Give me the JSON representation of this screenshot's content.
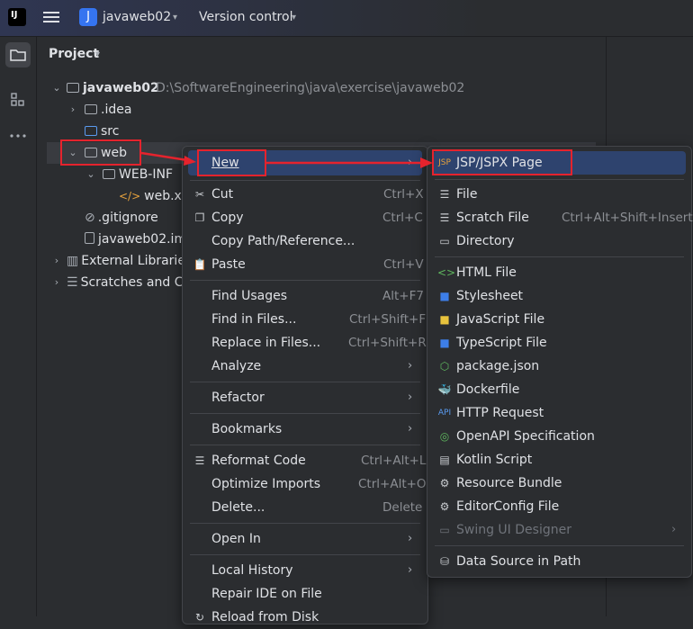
{
  "titlebar": {
    "logo": "IJ",
    "project_badge": "J",
    "project_name": "javaweb02",
    "vcs": "Version control"
  },
  "project_panel": {
    "title": "Project",
    "tree": {
      "root_name": "javaweb02",
      "root_path": "D:\\SoftwareEngineering\\java\\exercise\\javaweb02",
      "idea": ".idea",
      "src": "src",
      "web": "web",
      "webinf": "WEB-INF",
      "webxml": "web.xml",
      "gitignore": ".gitignore",
      "iml": "javaweb02.iml",
      "ext_libs": "External Libraries",
      "scratches": "Scratches and Consoles"
    }
  },
  "context_menu": {
    "new": "New",
    "cut": "Cut",
    "cut_sc": "Ctrl+X",
    "copy": "Copy",
    "copy_sc": "Ctrl+C",
    "copy_path": "Copy Path/Reference...",
    "paste": "Paste",
    "paste_sc": "Ctrl+V",
    "find_usages": "Find Usages",
    "find_usages_sc": "Alt+F7",
    "find_files": "Find in Files...",
    "find_files_sc": "Ctrl+Shift+F",
    "replace_files": "Replace in Files...",
    "replace_files_sc": "Ctrl+Shift+R",
    "analyze": "Analyze",
    "refactor": "Refactor",
    "bookmarks": "Bookmarks",
    "reformat": "Reformat Code",
    "reformat_sc": "Ctrl+Alt+L",
    "optimize": "Optimize Imports",
    "optimize_sc": "Ctrl+Alt+O",
    "delete": "Delete...",
    "delete_sc": "Delete",
    "open_in": "Open In",
    "local_history": "Local History",
    "repair": "Repair IDE on File",
    "reload": "Reload from Disk"
  },
  "new_submenu": {
    "jsp": "JSP/JSPX Page",
    "file": "File",
    "scratch": "Scratch File",
    "scratch_sc": "Ctrl+Alt+Shift+Insert",
    "directory": "Directory",
    "html": "HTML File",
    "stylesheet": "Stylesheet",
    "javascript": "JavaScript File",
    "typescript": "TypeScript File",
    "package_json": "package.json",
    "dockerfile": "Dockerfile",
    "http": "HTTP Request",
    "openapi": "OpenAPI Specification",
    "kotlin": "Kotlin Script",
    "resource_bundle": "Resource Bundle",
    "editorconfig": "EditorConfig File",
    "swing": "Swing UI Designer",
    "datasource": "Data Source in Path"
  },
  "colors": {
    "annotation": "#e5232d",
    "selection": "#2e436e",
    "accent": "#3574f0"
  }
}
